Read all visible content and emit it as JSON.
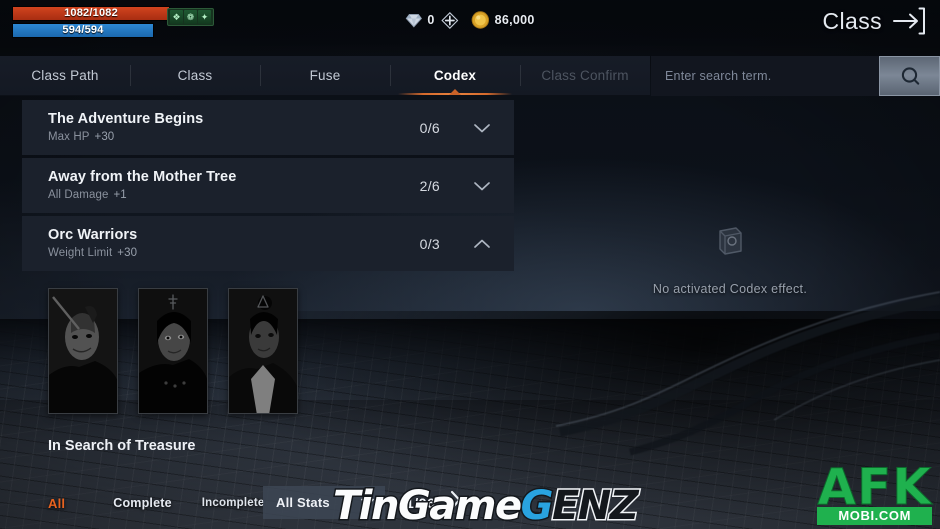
{
  "hud": {
    "hp": {
      "text": "1082/1082",
      "color": "#c0401c"
    },
    "mp": {
      "text": "594/594",
      "color": "#2d88d4"
    },
    "buffs": [
      {
        "name": "buff-icon-1",
        "glyph": "❖"
      },
      {
        "name": "buff-icon-2",
        "glyph": "❁"
      },
      {
        "name": "buff-icon-3",
        "glyph": "✦"
      }
    ],
    "diamond": {
      "icon": "diamond-icon",
      "value": "0"
    },
    "add_button": {
      "icon": "plus-icon"
    },
    "gold": {
      "icon": "gold-coin-icon",
      "value": "86,000"
    },
    "class_button": {
      "label": "Class",
      "icon": "exit-arrow-icon"
    }
  },
  "tabs": [
    {
      "label": "Class Path",
      "state": "normal"
    },
    {
      "label": "Class",
      "state": "normal"
    },
    {
      "label": "Fuse",
      "state": "normal"
    },
    {
      "label": "Codex",
      "state": "active"
    },
    {
      "label": "Class Confirm",
      "state": "disabled"
    }
  ],
  "search": {
    "placeholder": "Enter search term.",
    "value": "",
    "button_icon": "search-icon"
  },
  "codex_list": [
    {
      "title": "The Adventure Begins",
      "stat_label": "Max HP",
      "stat_value": "+30",
      "count": "0/6",
      "expanded": false,
      "chevron": "chevron-down-icon"
    },
    {
      "title": "Away from the Mother Tree",
      "stat_label": "All Damage",
      "stat_value": "+1",
      "count": "2/6",
      "expanded": false,
      "chevron": "chevron-down-icon"
    },
    {
      "title": "Orc Warriors",
      "stat_label": "Weight Limit",
      "stat_value": "+30",
      "count": "0/3",
      "expanded": true,
      "chevron": "chevron-up-icon"
    }
  ],
  "orc_cards": [
    {
      "name": "orc-warrior-card-1",
      "locked": true
    },
    {
      "name": "orc-warrior-card-2",
      "locked": true
    },
    {
      "name": "orc-warrior-card-3",
      "locked": true
    }
  ],
  "partial_row": {
    "title": "In Search of Treasure"
  },
  "effect_panel": {
    "icon": "codex-book-icon",
    "message": "No activated Codex effect."
  },
  "filters": [
    {
      "label": "All",
      "active": true
    },
    {
      "label": "Complete",
      "active": false
    },
    {
      "label": "Incomplete",
      "active": false
    }
  ],
  "stat_filter": {
    "label": "All Stats",
    "icon": "chevron-down-icon"
  },
  "pager": {
    "page": "1/26",
    "next_icon": "chevron-right-icon"
  },
  "watermarks": {
    "tingame": {
      "part1": "TinGame",
      "part2": "G",
      "part3": "ENZ"
    },
    "afk": {
      "big": "AFK",
      "small": "MOBI.COM",
      "color": "#1fb14e"
    }
  },
  "colors": {
    "accent": "#e8621f",
    "tab_underline": "#d66a2c",
    "panel": "#1b212c",
    "hud_bg": "#05080d"
  }
}
